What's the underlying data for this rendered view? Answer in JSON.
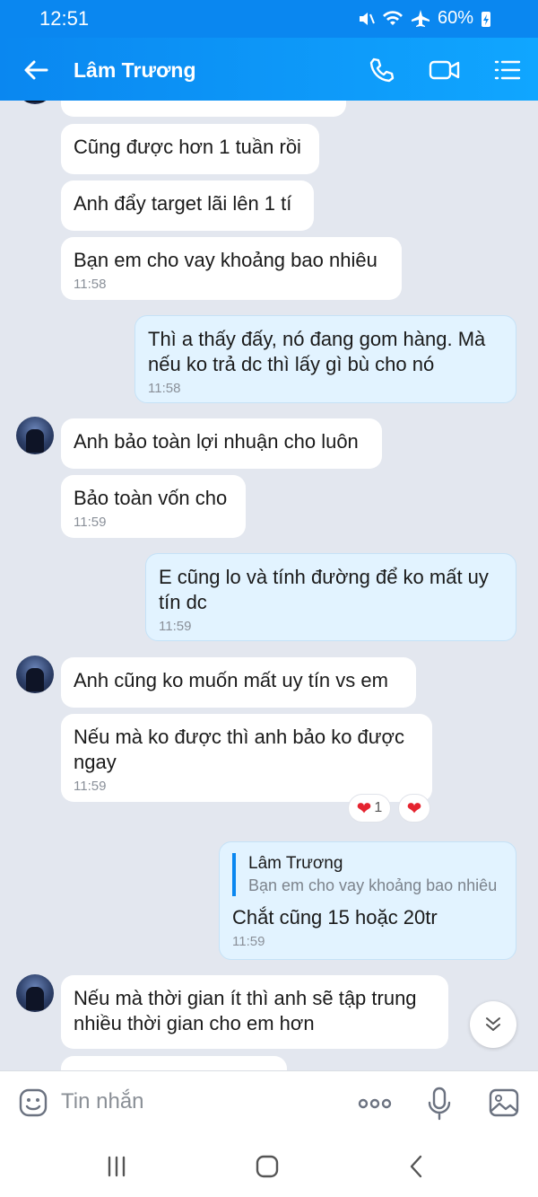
{
  "status_bar": {
    "time": "12:51",
    "battery": "60%"
  },
  "header": {
    "title": "Lâm Trương"
  },
  "messages": [
    {
      "text": "Cũng được hơn 1 tuần rồi",
      "time": ""
    },
    {
      "text": "Anh đẩy target lãi lên 1 tí",
      "time": ""
    },
    {
      "text": "Bạn em cho vay khoảng bao nhiêu",
      "time": "11:58"
    },
    {
      "text": "Thì a thấy đấy, nó đang gom hàng. Mà\nnếu ko trả dc thì lấy gì bù cho nó",
      "time": "11:58"
    },
    {
      "text": "Anh bảo toàn lợi nhuận cho luôn",
      "time": ""
    },
    {
      "text": "Bảo toàn vốn cho",
      "time": "11:59"
    },
    {
      "text": "E cũng lo và tính đường để ko mất uy\ntín dc",
      "time": "11:59"
    },
    {
      "text": "Anh cũng ko muốn mất uy tín vs em",
      "time": ""
    },
    {
      "text": "Nếu mà ko được thì anh bảo ko được\nngay",
      "time": "11:59"
    },
    {
      "text": "Chắt cũng 15 hoặc 20tr",
      "time": "11:59",
      "quote": {
        "name": "Lâm Trương",
        "text": "Bạn em cho vay khoảng bao nhiêu"
      }
    },
    {
      "text": "Nếu mà thời gian ít thì anh sẽ tập trung\nnhiều thời gian cho em hơn",
      "time": ""
    }
  ],
  "reactions": {
    "heart_count": "1",
    "heart_icon": "heart-icon",
    "heart_color": "#e5232f"
  },
  "composer": {
    "placeholder": "Tin nhắn"
  },
  "colors": {
    "accent": "#0a87f0",
    "chat_bg": "#e3e7ef",
    "my_bubble": "#e2f3ff"
  }
}
